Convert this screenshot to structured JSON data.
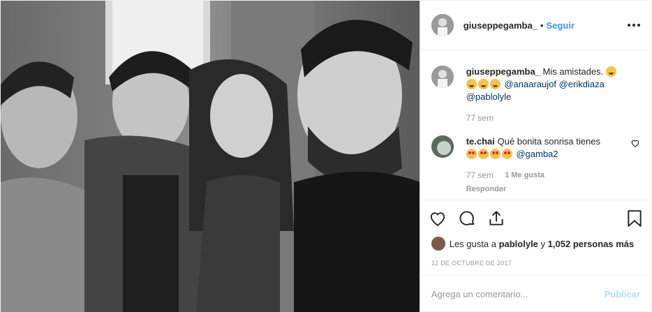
{
  "header": {
    "username": "giuseppegamba_",
    "separator": "•",
    "follow_label": "Seguir"
  },
  "caption": {
    "username": "giuseppegamba_",
    "text": "Mis amistades.",
    "mentions": [
      "@anaaraujof",
      "@erikdiaza",
      "@pablolyle"
    ],
    "time": "77 sem"
  },
  "comment": {
    "username": "te.chai",
    "text": "Qué bonita sonrisa tienes",
    "mention": "@gamba2",
    "time": "77 sem",
    "likes": "1 Me gusta",
    "reply_label": "Responder"
  },
  "likes_line": {
    "prefix": "Les gusta a",
    "user": "pablolyle",
    "joiner": "y",
    "count": "1,052 personas más"
  },
  "date": "12 DE OCTUBRE DE 2017",
  "add_comment": {
    "placeholder": "Agrega un comentario...",
    "publish_label": "Publicar"
  },
  "icons": {
    "like": "heart-icon",
    "comment": "comment-icon",
    "share": "share-icon",
    "save": "bookmark-icon",
    "more": "more-options-icon"
  },
  "colors": {
    "follow": "#3897f0",
    "mention": "#003569",
    "publish_disabled": "#b2dffc",
    "muted": "#999999"
  }
}
